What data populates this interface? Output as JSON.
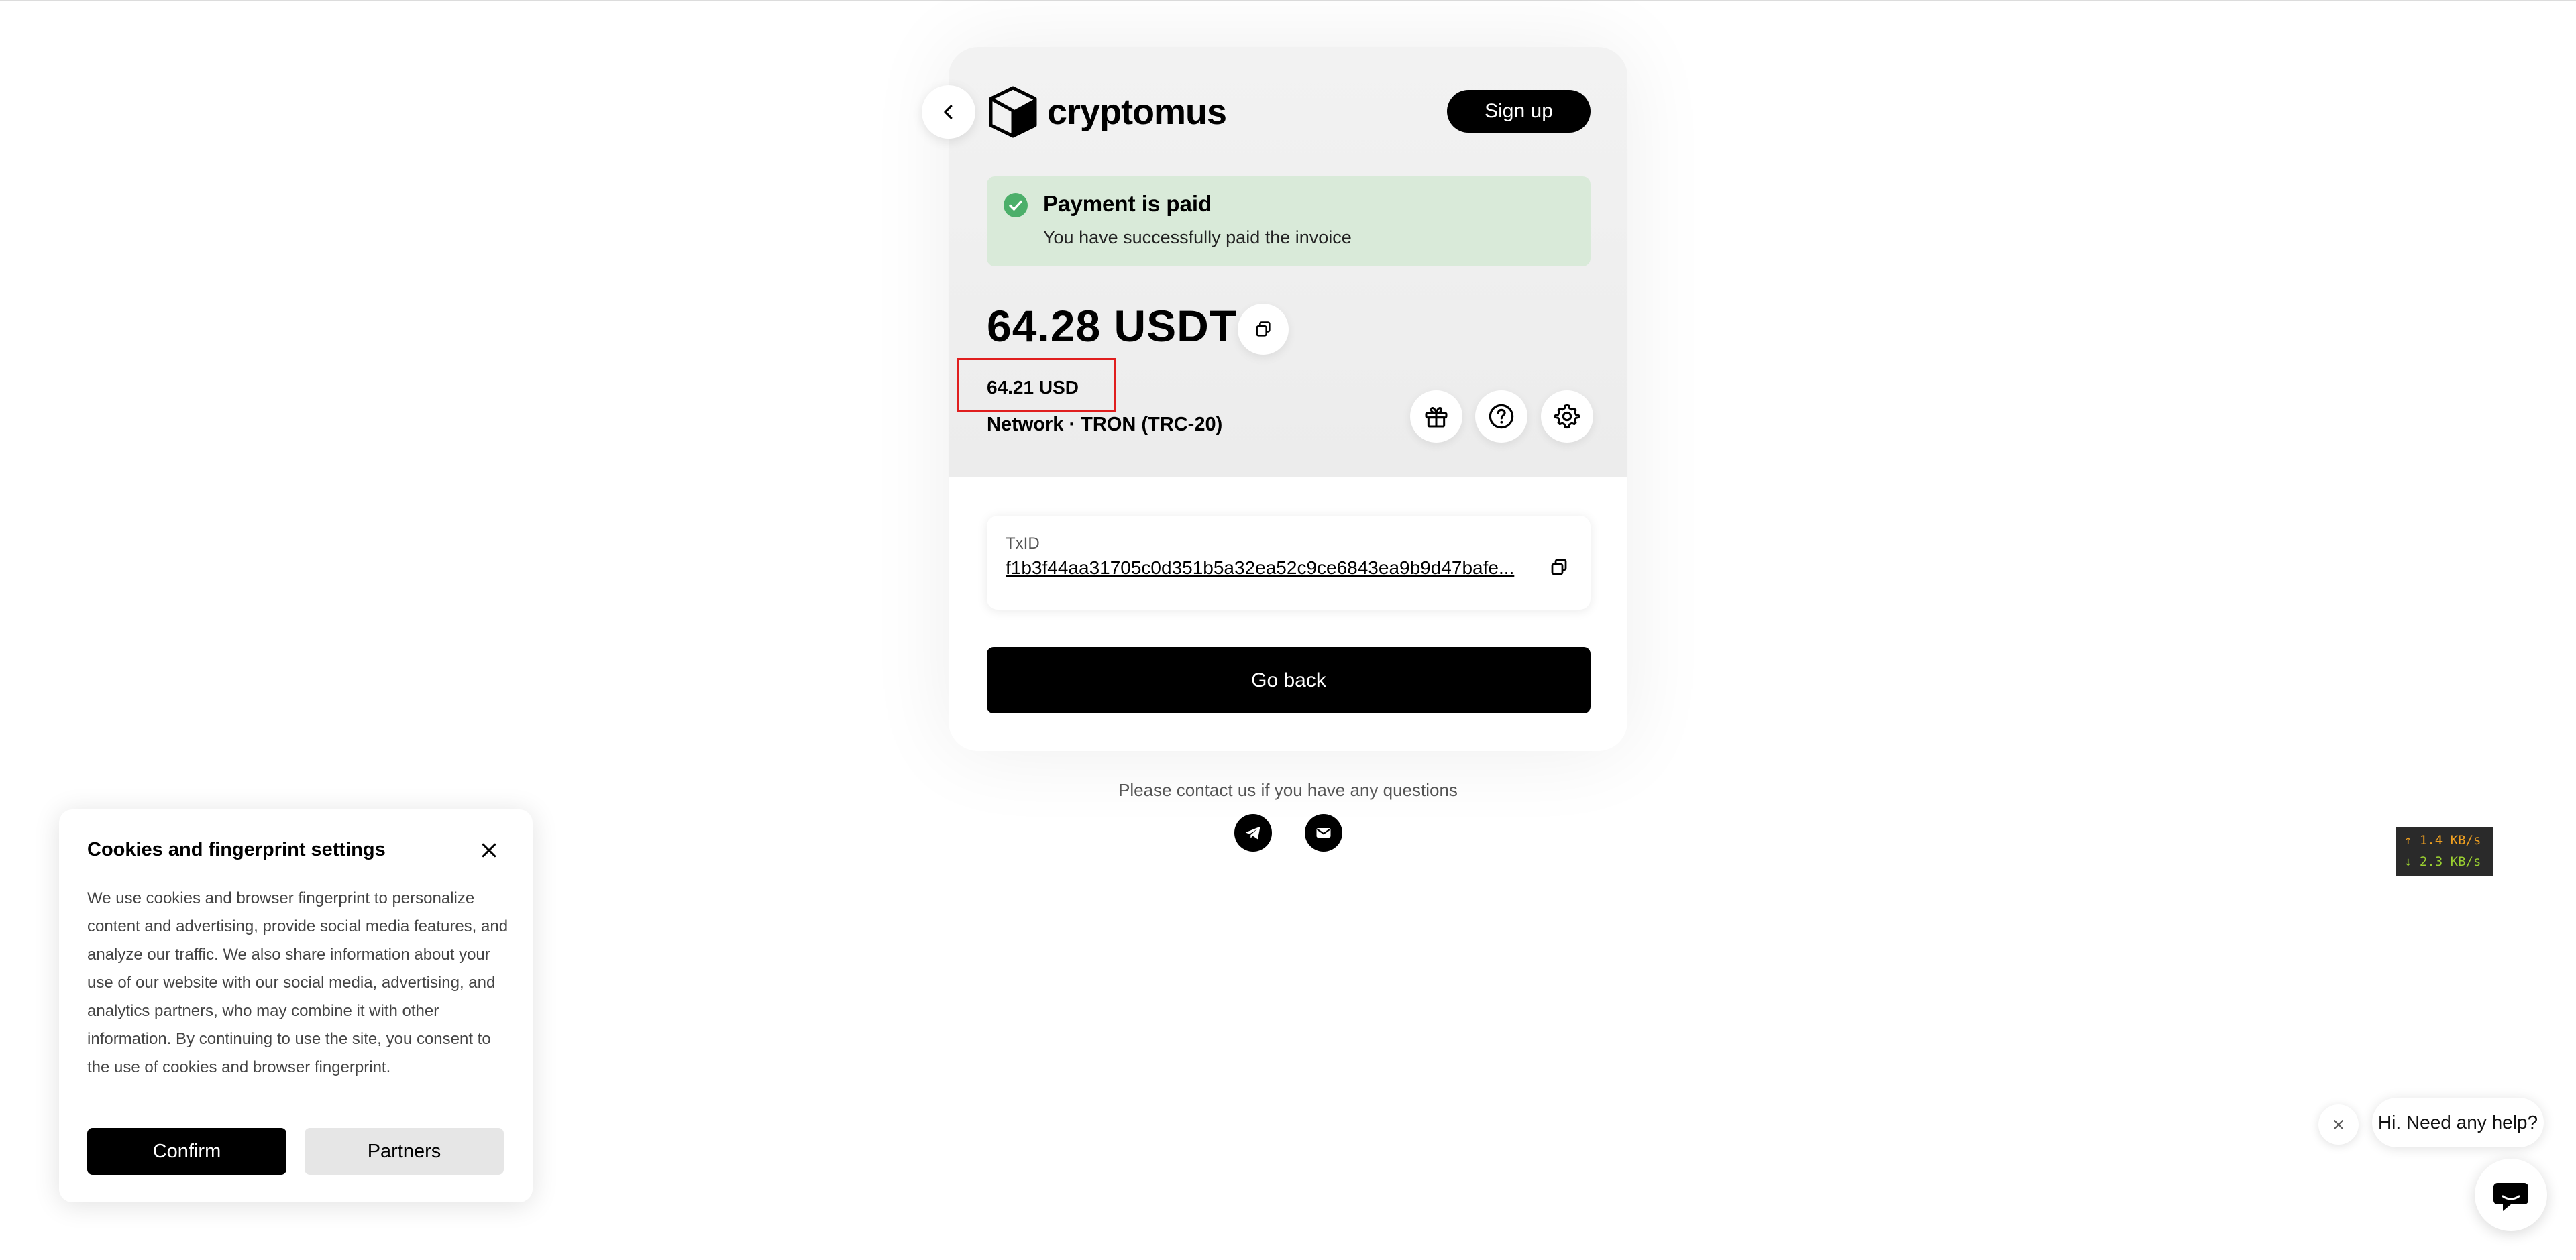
{
  "header": {
    "brand": "cryptomus",
    "signup_label": "Sign up"
  },
  "status": {
    "title": "Payment is paid",
    "subtitle": "You have successfully paid the invoice",
    "color": "#4caf6a"
  },
  "payment": {
    "amount": "64.28 USDT",
    "fiat_amount": "64.21 USD",
    "network": "Network · TRON (TRC-20)"
  },
  "transaction": {
    "label": "TxID",
    "value": "f1b3f44aa31705c0d351b5a32ea52c9ce6843ea9b9d47bafe..."
  },
  "actions": {
    "go_back_label": "Go back"
  },
  "contact": {
    "text": "Please contact us if you have any questions",
    "icons": [
      "telegram-icon",
      "mail-icon"
    ]
  },
  "cookies": {
    "title": "Cookies and fingerprint settings",
    "text": "We use cookies and browser fingerprint to personalize content and advertising, provide social media features, and analyze our traffic. We also share information about your use of our website with our social media, advertising, and analytics partners, who may combine it with other information. By continuing to use the site, you consent to the use of cookies and browser fingerprint.",
    "confirm_label": "Confirm",
    "partners_label": "Partners"
  },
  "netspeed": {
    "up": "↑ 1.4 KB/s",
    "down": "↓ 2.3 KB/s"
  },
  "chat": {
    "greeting": "Hi. Need any help?"
  },
  "colors": {
    "accent": "#000000",
    "highlight_box": "#e01e1e",
    "status_bg": "#d9ead9"
  }
}
